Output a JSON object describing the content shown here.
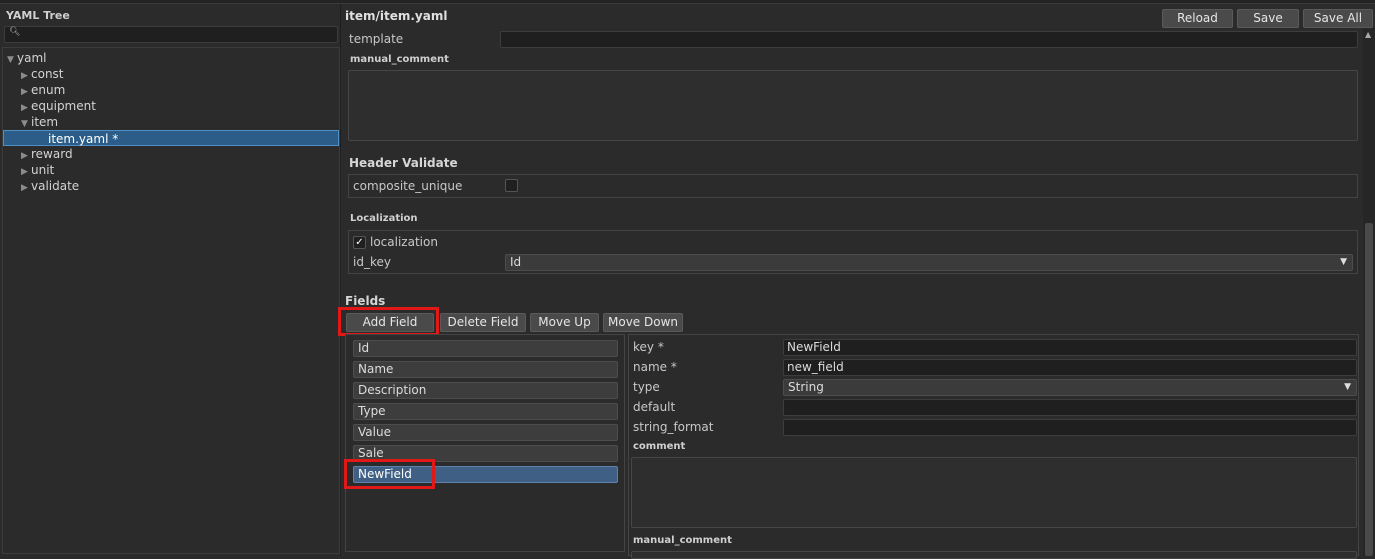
{
  "tree_panel": {
    "title": "YAML Tree",
    "search": {
      "value": "",
      "icon": "search-icon"
    },
    "items": [
      {
        "label": "yaml",
        "expanded": true
      },
      {
        "label": "const"
      },
      {
        "label": "enum"
      },
      {
        "label": "equipment"
      },
      {
        "label": "item",
        "expanded": true
      },
      {
        "label": "item.yaml *",
        "selected": true
      },
      {
        "label": "reward"
      },
      {
        "label": "unit"
      },
      {
        "label": "validate"
      }
    ]
  },
  "editor": {
    "file_title": "item/item.yaml",
    "toolbar": {
      "reload": "Reload",
      "save": "Save",
      "save_all": "Save All"
    },
    "template_label": "template",
    "template_value": "",
    "manual_comment_label": "manual_comment",
    "header_validate": {
      "title": "Header Validate",
      "composite_unique_label": "composite_unique",
      "composite_unique_checked": false
    },
    "localization": {
      "title": "Localization",
      "checkbox_label": "localization",
      "checked": true,
      "id_key_label": "id_key",
      "id_key_value": "Id"
    },
    "fields": {
      "title": "Fields",
      "buttons": {
        "add": "Add Field",
        "delete": "Delete Field",
        "move_up": "Move Up",
        "move_down": "Move Down"
      },
      "list": [
        "Id",
        "Name",
        "Description",
        "Type",
        "Value",
        "Sale",
        "NewField"
      ],
      "selected": "NewField",
      "detail": {
        "key_label": "key *",
        "key_value": "NewField",
        "name_label": "name *",
        "name_value": "new_field",
        "type_label": "type",
        "type_value": "String",
        "default_label": "default",
        "default_value": "",
        "string_format_label": "string_format",
        "string_format_value": "",
        "comment_label": "comment",
        "manual_comment_label": "manual_comment"
      }
    }
  },
  "colors": {
    "background": "#2b2b2b",
    "selection": "#2c5d88",
    "highlight": "#e01818"
  }
}
